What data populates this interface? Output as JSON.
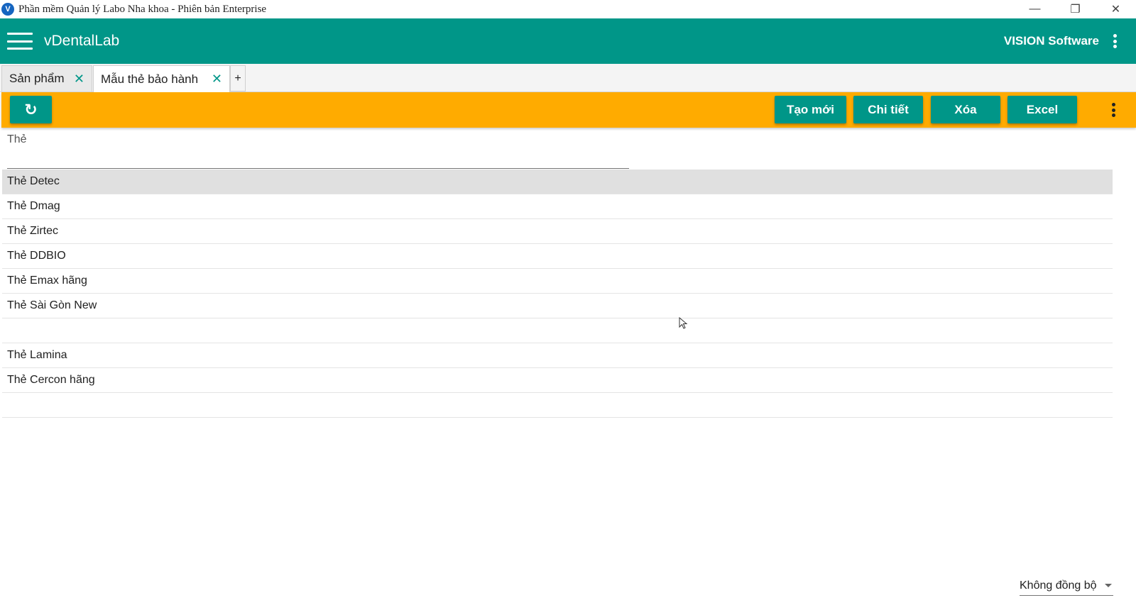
{
  "window": {
    "title": "Phần mềm Quản lý Labo Nha khoa - Phiên bản Enterprise",
    "logo_letter": "V",
    "minimize_glyph": "—",
    "restore_glyph": "❐",
    "close_glyph": "✕"
  },
  "appbar": {
    "app_name": "vDentalLab",
    "brand": "VISION Software"
  },
  "tabs": [
    {
      "label": "Sản phẩm",
      "close": "✕"
    },
    {
      "label": "Mẫu thẻ bảo hành",
      "close": "✕"
    }
  ],
  "tab_add": "+",
  "toolbar": {
    "refresh_glyph": "↻",
    "new_label": "Tạo mới",
    "detail_label": "Chi tiết",
    "delete_label": "Xóa",
    "excel_label": "Excel"
  },
  "filter": {
    "label": "Thẻ",
    "value": ""
  },
  "rows": [
    "Thẻ Detec",
    "Thẻ Dmag",
    "Thẻ Zirtec",
    "Thẻ DDBIO",
    "Thẻ Emax hãng",
    "Thẻ Sài Gòn New",
    "",
    "Thẻ Lamina",
    "Thẻ Cercon hãng",
    ""
  ],
  "selected_row": 0,
  "sync": {
    "selected": "Không đồng bộ"
  },
  "colors": {
    "primary": "#009688",
    "toolbar": "#ffab00",
    "selected_row": "#e0e0e0"
  }
}
